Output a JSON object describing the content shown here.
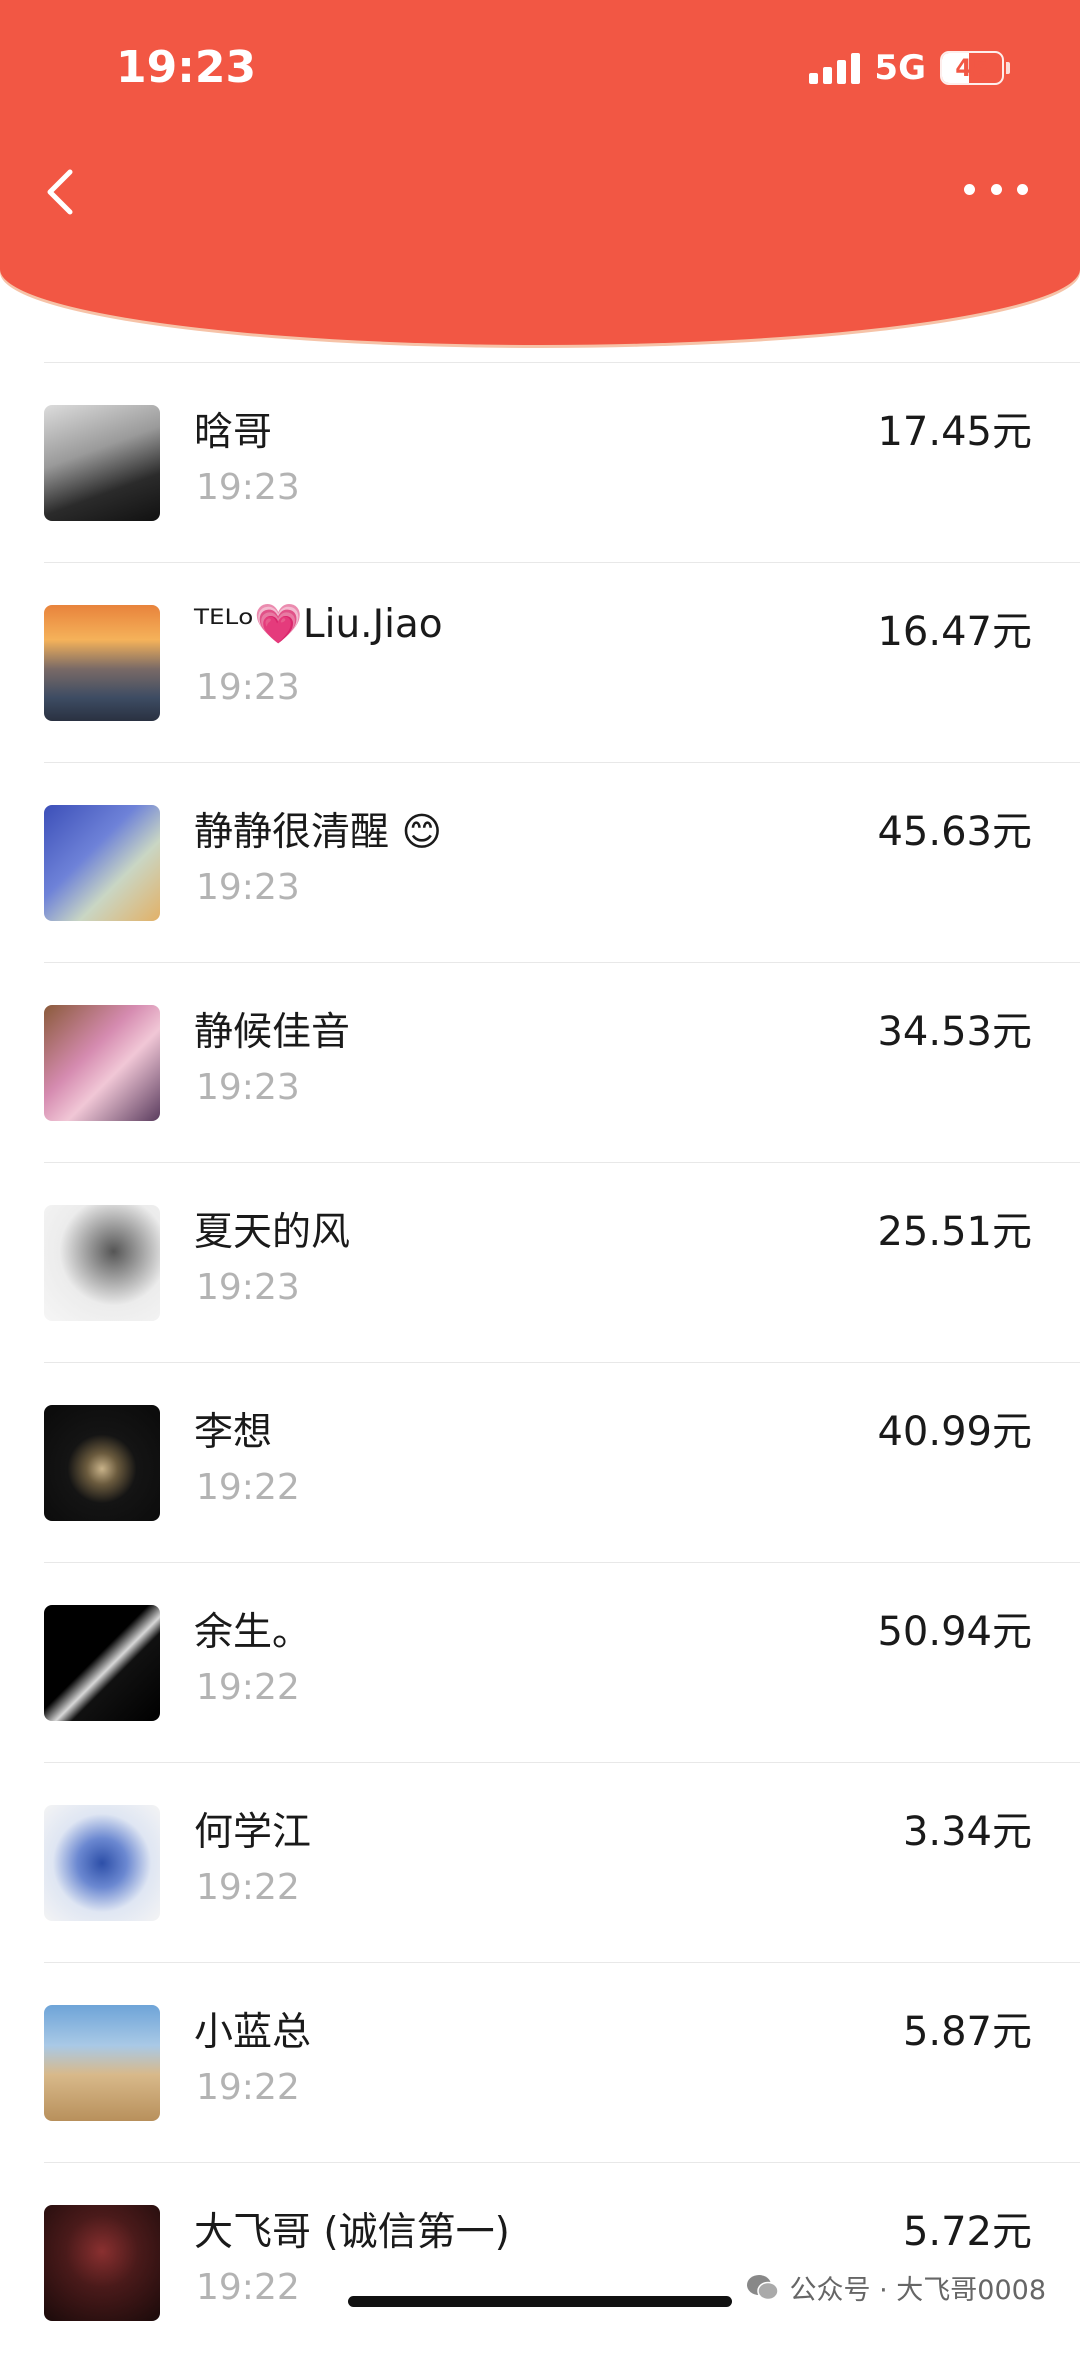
{
  "status_bar": {
    "time": "19:23",
    "network": "5G",
    "battery": "45"
  },
  "rows": [
    {
      "name": "晗哥",
      "time": "19:23",
      "amount": "17.45元"
    },
    {
      "name": "ᵀᴱᴸᵒ💗Liu.Jiao",
      "time": "19:23",
      "amount": "16.47元"
    },
    {
      "name": "静静很清醒 😊",
      "time": "19:23",
      "amount": "45.63元"
    },
    {
      "name": "静候佳音",
      "time": "19:23",
      "amount": "34.53元"
    },
    {
      "name": "夏天的风",
      "time": "19:23",
      "amount": "25.51元"
    },
    {
      "name": "李想",
      "time": "19:22",
      "amount": "40.99元"
    },
    {
      "name": "余生。",
      "time": "19:22",
      "amount": "50.94元"
    },
    {
      "name": "何学江",
      "time": "19:22",
      "amount": "3.34元"
    },
    {
      "name": "小蓝总",
      "time": "19:22",
      "amount": "5.87元"
    },
    {
      "name": "大飞哥 (诚信第一)",
      "time": "19:22",
      "amount": "5.72元"
    }
  ],
  "watermark": {
    "text": "公众号 · 大飞哥0008"
  },
  "colors": {
    "header": "#f25744",
    "header_rim": "#f6c3a8",
    "time_gray": "#b3b3b3"
  },
  "icons": {
    "back": "chevron-left-icon",
    "more": "more-dots-icon",
    "watermark": "wechat-icon"
  }
}
